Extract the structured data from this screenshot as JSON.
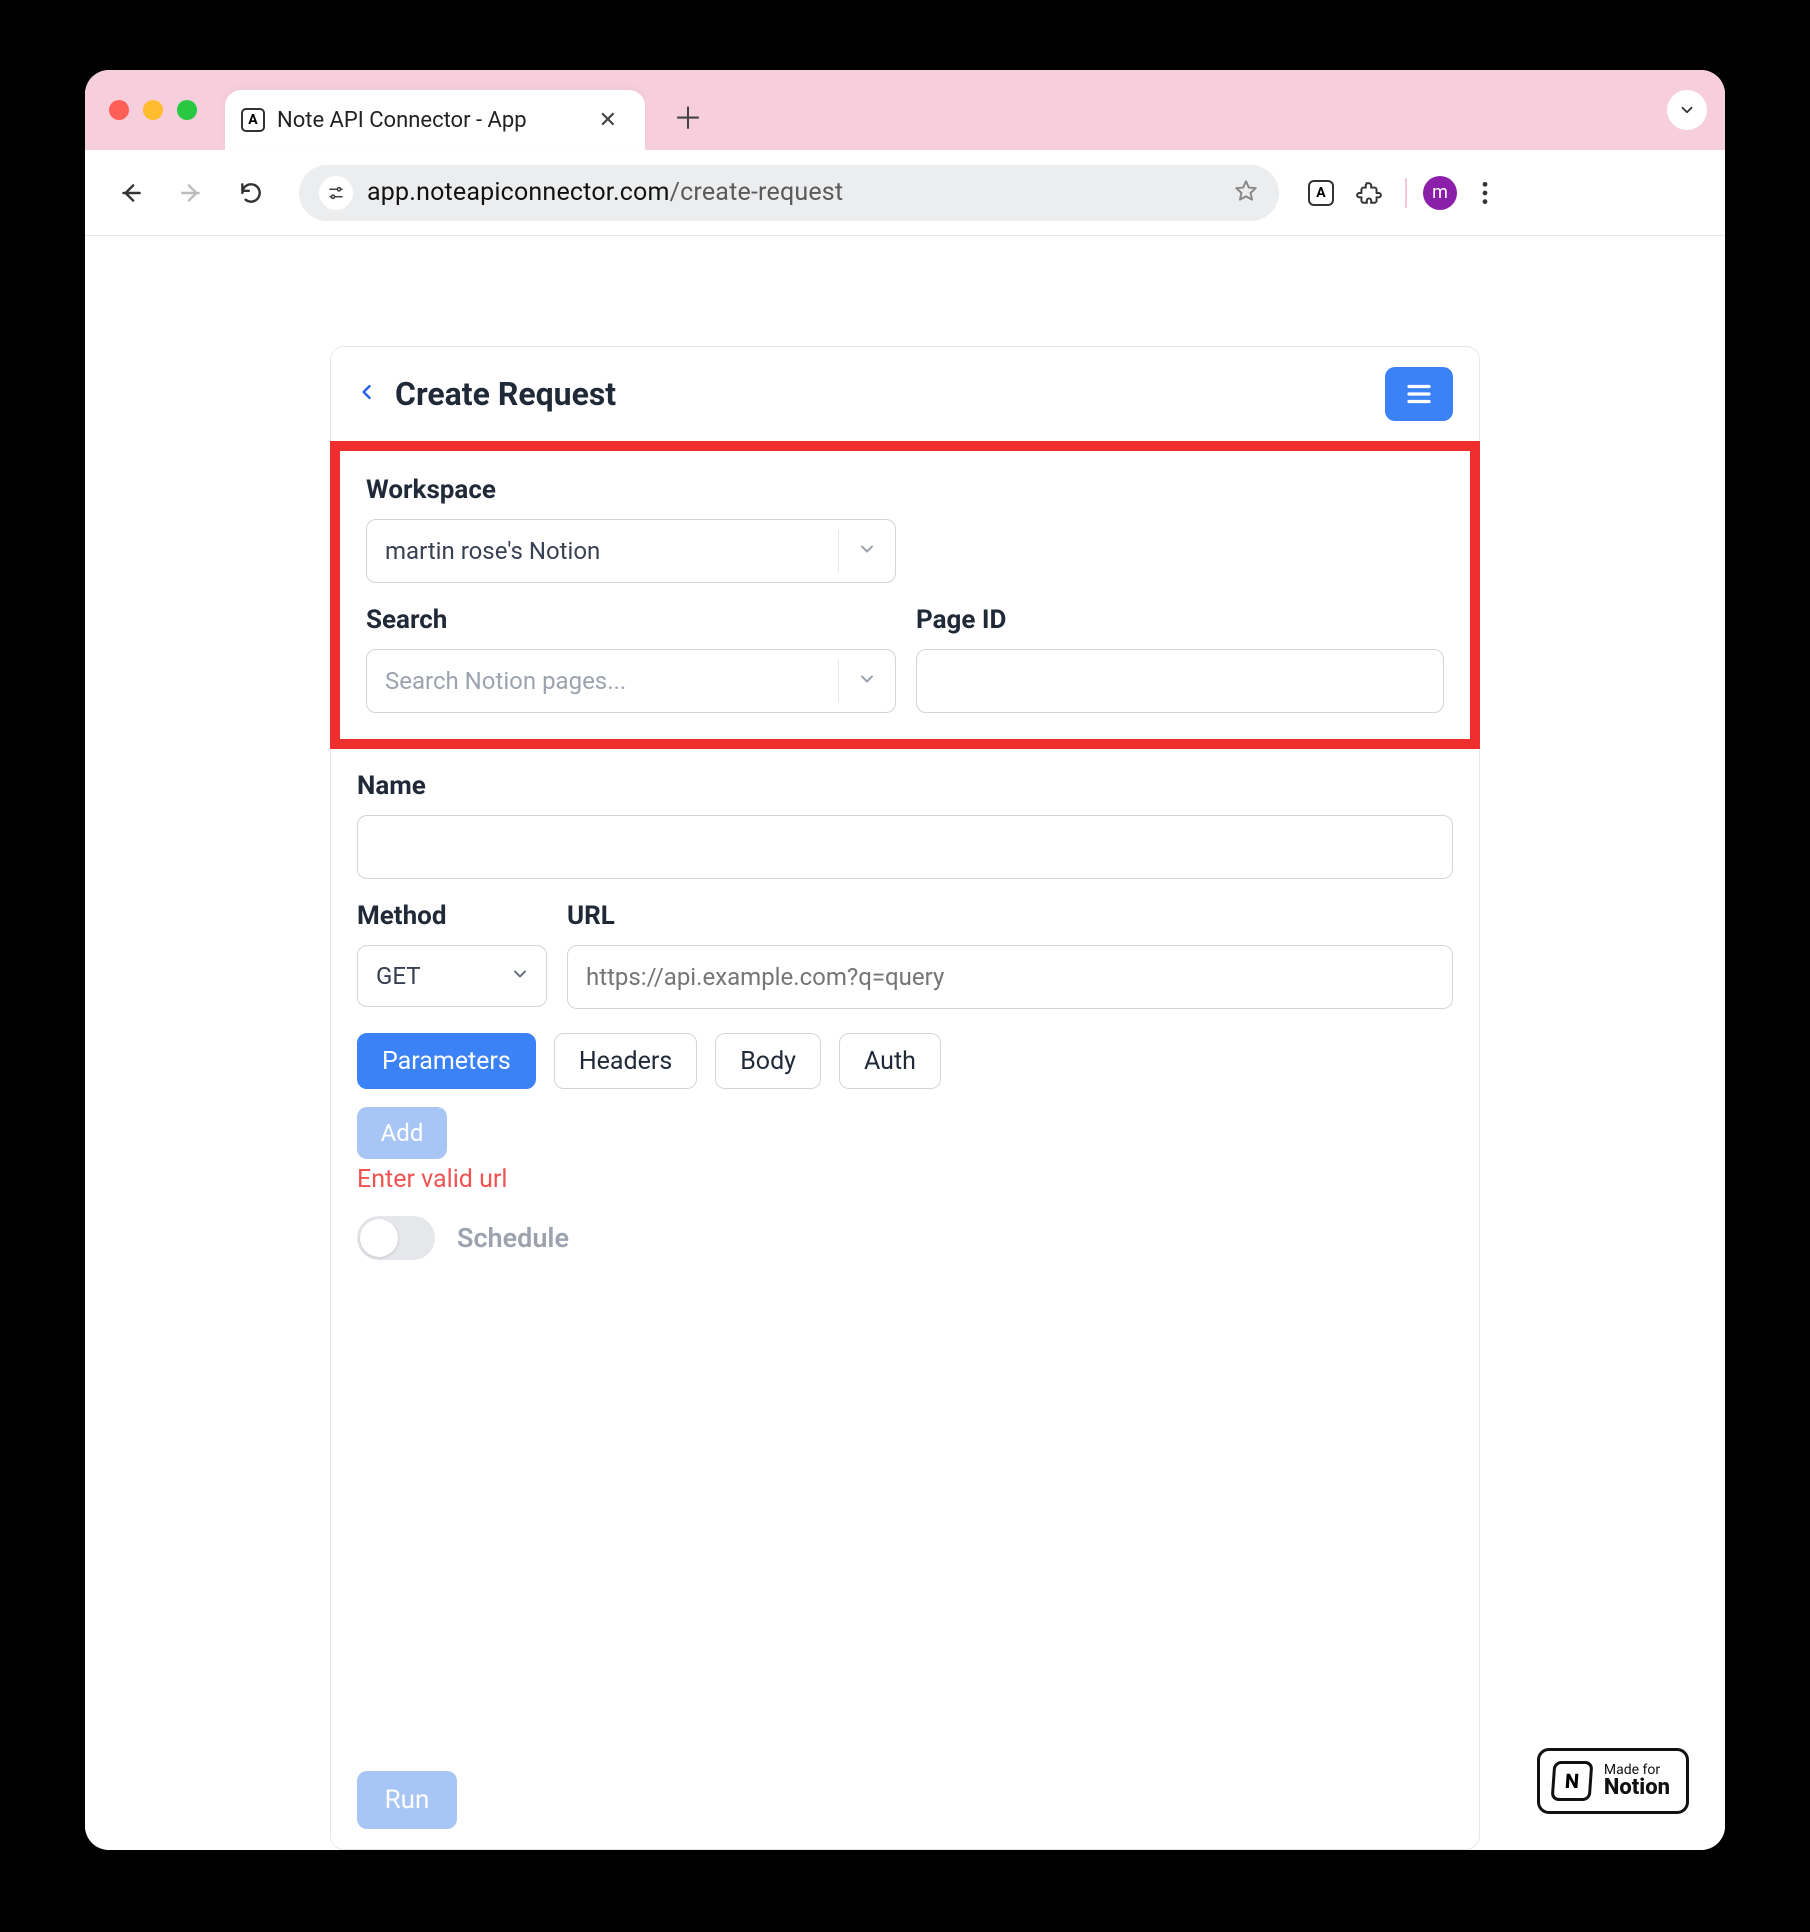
{
  "browser": {
    "tab_title": "Note API Connector - App",
    "url_domain": "app.noteapiconnector.com",
    "url_path": "/create-request",
    "avatar_initial": "m"
  },
  "header": {
    "title": "Create Request"
  },
  "workspace": {
    "label": "Workspace",
    "selected": "martin rose's Notion"
  },
  "search": {
    "label": "Search",
    "placeholder": "Search Notion pages..."
  },
  "page_id": {
    "label": "Page ID",
    "value": ""
  },
  "name": {
    "label": "Name",
    "value": ""
  },
  "method": {
    "label": "Method",
    "selected": "GET"
  },
  "url_field": {
    "label": "URL",
    "placeholder": "https://api.example.com?q=query",
    "value": ""
  },
  "tabs": {
    "parameters": "Parameters",
    "headers": "Headers",
    "body": "Body",
    "auth": "Auth"
  },
  "add_button": "Add",
  "error_text": "Enter valid url",
  "schedule_label": "Schedule",
  "run_button": "Run",
  "notion_badge": {
    "small": "Made for",
    "big": "Notion"
  }
}
